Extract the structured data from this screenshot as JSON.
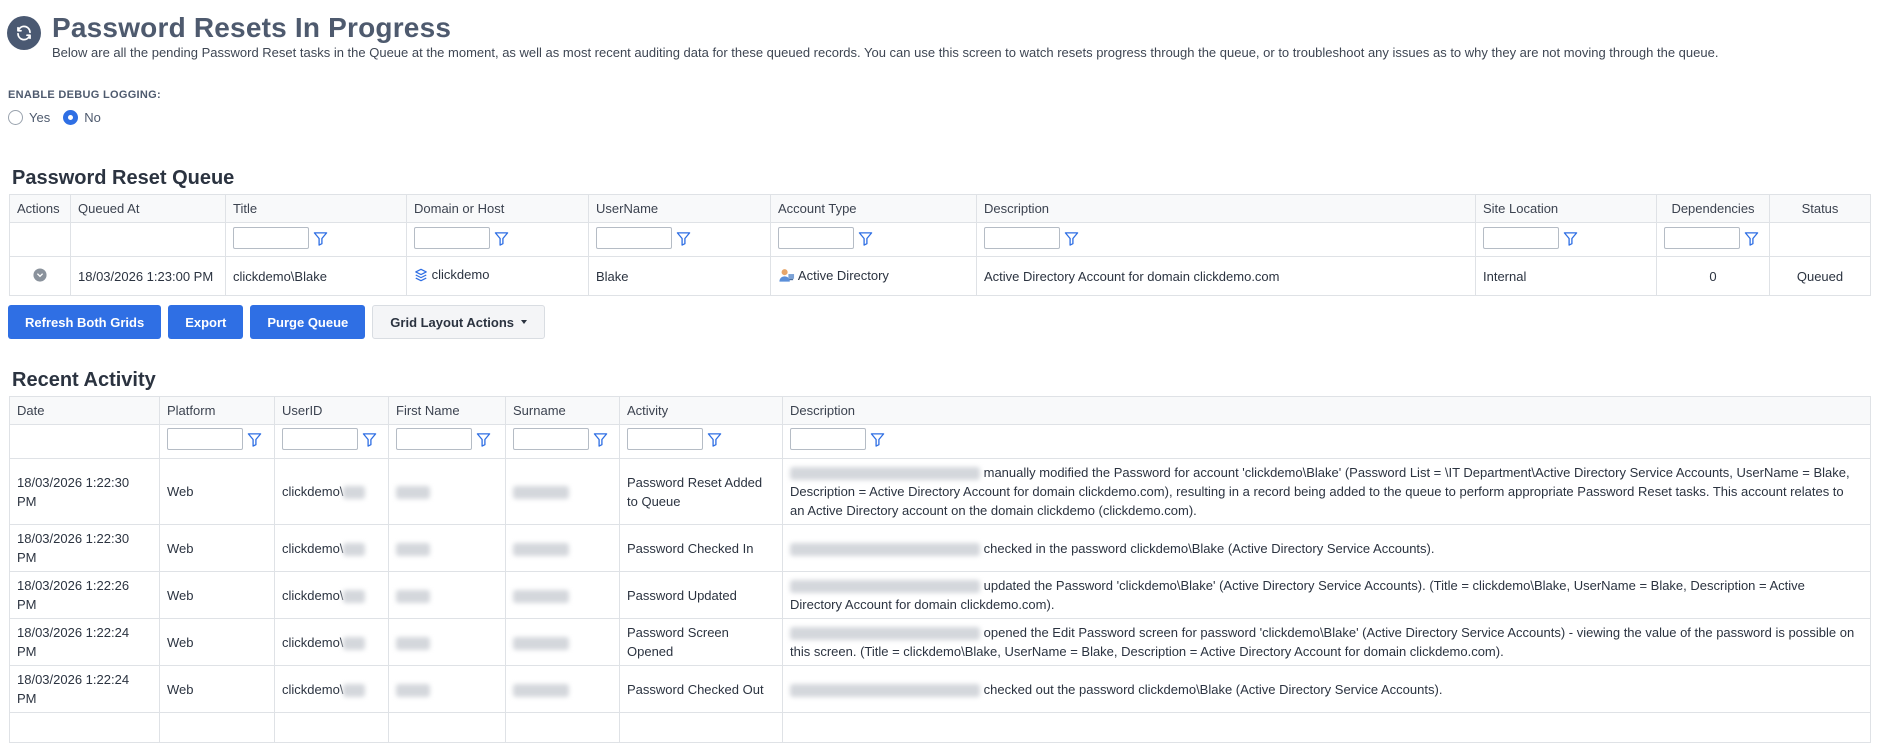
{
  "header": {
    "title": "Password Resets In Progress",
    "description": "Below are all the pending Password Reset tasks in the Queue at the moment, as well as most recent auditing data for these queued records. You can use this screen to watch resets progress through the queue, or to troubleshoot any issues as to why they are not moving through the queue.",
    "icon": "refresh-icon"
  },
  "debug": {
    "label": "ENABLE DEBUG LOGGING:",
    "options": [
      "Yes",
      "No"
    ],
    "selected": "No"
  },
  "queue": {
    "title": "Password Reset Queue",
    "columns": [
      "Actions",
      "Queued At",
      "Title",
      "Domain or Host",
      "UserName",
      "Account Type",
      "Description",
      "Site Location",
      "Dependencies",
      "Status"
    ],
    "row": {
      "queued_at": "18/03/2026 1:23:00 PM",
      "title": "clickdemo\\Blake",
      "domain": "clickdemo",
      "username": "Blake",
      "account_type": "Active Directory",
      "description": "Active Directory Account for domain clickdemo.com",
      "site_location": "Internal",
      "dependencies": "0",
      "status": "Queued"
    }
  },
  "buttons": {
    "refresh": "Refresh Both Grids",
    "export": "Export",
    "purge": "Purge Queue",
    "layout": "Grid Layout Actions"
  },
  "activity": {
    "title": "Recent Activity",
    "columns": [
      "Date",
      "Platform",
      "UserID",
      "First Name",
      "Surname",
      "Activity",
      "Description"
    ],
    "rows": [
      {
        "date_line1": "18/03/2026 1:22:30",
        "date_line2": "PM",
        "platform": "Web",
        "userid": "clickdemo\\",
        "activity_line1": "Password Reset Added",
        "activity_line2": "to Queue",
        "desc_line1": "manually modified the Password for account 'clickdemo\\Blake' (Password List = \\IT Department\\Active Directory Service Accounts, UserName = Blake,",
        "desc_line2": "Description = Active Directory Account for domain clickdemo.com), resulting in a record being added to the queue to perform appropriate Password Reset tasks. This account relates to",
        "desc_line3": "an Active Directory account on the domain clickdemo (clickdemo.com)."
      },
      {
        "date_line1": "18/03/2026 1:22:30",
        "date_line2": "PM",
        "platform": "Web",
        "userid": "clickdemo\\",
        "activity_line1": "Password Checked In",
        "activity_line2": "",
        "desc_line1": "checked in the password clickdemo\\Blake (Active Directory Service Accounts).",
        "desc_line2": "",
        "desc_line3": ""
      },
      {
        "date_line1": "18/03/2026 1:22:26",
        "date_line2": "PM",
        "platform": "Web",
        "userid": "clickdemo\\",
        "activity_line1": "Password Updated",
        "activity_line2": "",
        "desc_line1": "updated the Password 'clickdemo\\Blake' (Active Directory Service Accounts). (Title = clickdemo\\Blake, UserName = Blake, Description = Active",
        "desc_line2": "Directory Account for domain clickdemo.com).",
        "desc_line3": ""
      },
      {
        "date_line1": "18/03/2026 1:22:24",
        "date_line2": "PM",
        "platform": "Web",
        "userid": "clickdemo\\",
        "activity_line1": "Password Screen",
        "activity_line2": "Opened",
        "desc_line1": "opened the Edit Password screen for password 'clickdemo\\Blake' (Active Directory Service Accounts) - viewing the value of the password is possible on",
        "desc_line2": "this screen. (Title = clickdemo\\Blake, UserName = Blake, Description = Active Directory Account for domain clickdemo.com).",
        "desc_line3": ""
      },
      {
        "date_line1": "18/03/2026 1:22:24",
        "date_line2": "PM",
        "platform": "Web",
        "userid": "clickdemo\\",
        "activity_line1": "Password Checked Out",
        "activity_line2": "",
        "desc_line1": "checked out the password clickdemo\\Blake (Active Directory Service Accounts).",
        "desc_line2": "",
        "desc_line3": ""
      }
    ]
  },
  "colors": {
    "accent": "#2f6fe4",
    "title": "#4e5a6e",
    "icon_bg": "#4a5972"
  }
}
